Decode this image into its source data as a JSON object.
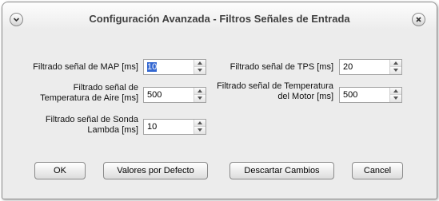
{
  "window": {
    "title": "Configuración Avanzada - Filtros Señales de Entrada"
  },
  "icons": {
    "menu": "chevron-down-icon",
    "close": "close-icon",
    "spin_up": "arrow-up-icon",
    "spin_down": "arrow-down-icon"
  },
  "fields": {
    "map": {
      "label": "Filtrado señal de MAP [ms]",
      "value": "10"
    },
    "tps": {
      "label": "Filtrado señal de TPS [ms]",
      "value": "20"
    },
    "air_temp": {
      "label_line1": "Filtrado señal de",
      "label_line2": "Temperatura de Aire  [ms]",
      "value": "500"
    },
    "motor_temp": {
      "label_line1": "Filtrado señal de Temperatura",
      "label_line2": "del Motor  [ms]",
      "value": "500"
    },
    "lambda": {
      "label_line1": "Filtrado señal de Sonda",
      "label_line2": "Lambda  [ms]",
      "value": "10"
    }
  },
  "buttons": {
    "ok": "OK",
    "defaults": "Valores por Defecto",
    "discard": "Descartar Cambios",
    "cancel": "Cancel"
  },
  "colors": {
    "window_bg": "#ececec",
    "selection": "#3875d7"
  }
}
